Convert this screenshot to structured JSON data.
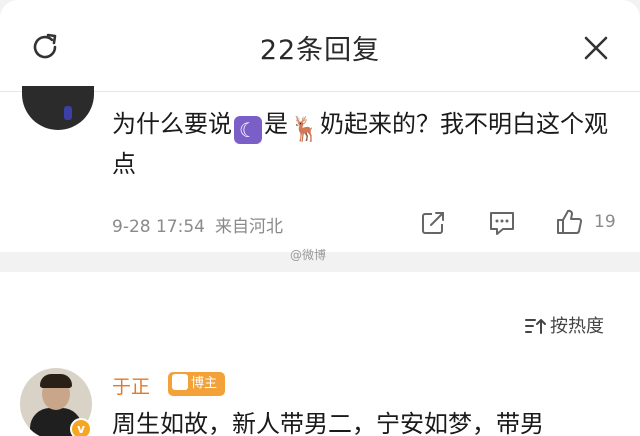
{
  "header": {
    "title": "22条回复",
    "refresh_icon": "refresh-icon",
    "close_icon": "close-icon"
  },
  "comment1": {
    "username_partial": "",
    "text_part1": "为什么要说",
    "moon_emoji": "☾",
    "text_part2": "是",
    "deer_emoji": "🦌",
    "text_part3": "奶起来的？我不明白这个观点",
    "timestamp": "9-28 17:54",
    "location": "来自河北",
    "like_count": "19",
    "icons": [
      "share-icon",
      "reply-icon",
      "like-icon"
    ]
  },
  "watermark": "@微博",
  "sort": {
    "label": "按热度",
    "icon": "sort-icon"
  },
  "comment2": {
    "username": "于正",
    "badge": "博主",
    "verified_badge": "v",
    "text": "周生如故，新人带男二，宁安如梦，带男"
  },
  "colors": {
    "username_orange": "#e07a2a",
    "badge_orange": "#f3a23a",
    "meta_gray": "#8a8a8a"
  }
}
